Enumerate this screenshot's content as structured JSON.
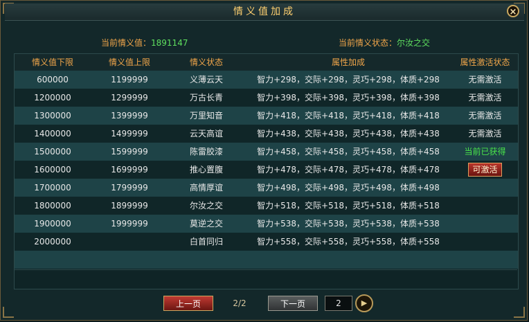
{
  "window": {
    "title": "情义值加成",
    "close_label": "×"
  },
  "status": {
    "current_value_label": "当前情义值：",
    "current_value": "1891147",
    "current_state_label": "当前情义状态：",
    "current_state": "尔汝之交"
  },
  "table": {
    "headers": [
      "情义值下限",
      "情义值上限",
      "情义状态",
      "属性加成",
      "属性激活状态"
    ],
    "rows": [
      {
        "min": "600000",
        "max": "1199999",
        "state": "义薄云天",
        "bonus": "智力+298，交际+298，灵巧+298，体质+298",
        "activation": "无需激活"
      },
      {
        "min": "1200000",
        "max": "1299999",
        "state": "万古长青",
        "bonus": "智力+398，交际+398，灵巧+398，体质+398",
        "activation": "无需激活"
      },
      {
        "min": "1300000",
        "max": "1399999",
        "state": "万里知音",
        "bonus": "智力+418，交际+418，灵巧+418，体质+418",
        "activation": "无需激活"
      },
      {
        "min": "1400000",
        "max": "1499999",
        "state": "云天高谊",
        "bonus": "智力+438，交际+438，灵巧+438，体质+438",
        "activation": "无需激活"
      },
      {
        "min": "1500000",
        "max": "1599999",
        "state": "陈雷胶漆",
        "bonus": "智力+458，交际+458，灵巧+458，体质+458",
        "activation": "当前已获得"
      },
      {
        "min": "1600000",
        "max": "1699999",
        "state": "推心置腹",
        "bonus": "智力+478，交际+478，灵巧+478，体质+478",
        "activation": "可激活"
      },
      {
        "min": "1700000",
        "max": "1799999",
        "state": "高情厚谊",
        "bonus": "智力+498，交际+498，灵巧+498，体质+498",
        "activation": ""
      },
      {
        "min": "1800000",
        "max": "1899999",
        "state": "尔汝之交",
        "bonus": "智力+518，交际+518，灵巧+518，体质+518",
        "activation": ""
      },
      {
        "min": "1900000",
        "max": "1999999",
        "state": "莫逆之交",
        "bonus": "智力+538，交际+538，灵巧+538，体质+538",
        "activation": ""
      },
      {
        "min": "2000000",
        "max": "",
        "state": "白首同归",
        "bonus": "智力+558，交际+558，灵巧+558，体质+558",
        "activation": ""
      }
    ]
  },
  "pager": {
    "prev_label": "上一页",
    "next_label": "下一页",
    "page_info": "2/2",
    "page_input": "2"
  },
  "colors": {
    "accent_orange": "#f2a64a",
    "value_green": "#5fe05f"
  }
}
